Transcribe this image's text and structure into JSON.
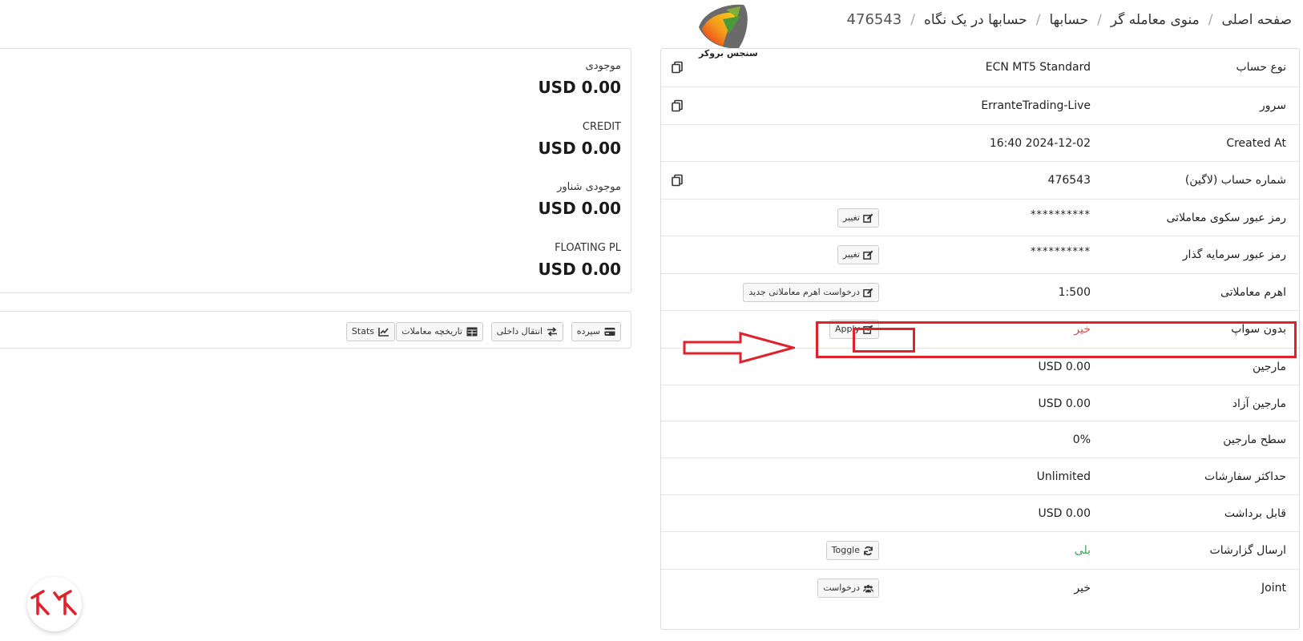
{
  "breadcrumb": {
    "home": "صفحه اصلی",
    "trader_menu": "منوی معامله گر",
    "accounts": "حسابها",
    "accounts_overview": "حسابها در یک نگاه",
    "account_id": "476543"
  },
  "logo": {
    "text": "سنجس بروکر"
  },
  "account": {
    "rows": [
      {
        "label": "نوع حساب",
        "value": "ECN MT5 Standard"
      },
      {
        "label": "سرور",
        "value": "ErranteTrading-Live"
      },
      {
        "label": "Created At",
        "value": "16:40 2024-12-02"
      },
      {
        "label": "شماره حساب (لاگین)",
        "value": "476543"
      },
      {
        "label": "رمز عبور سکوی معاملاتی",
        "value": "**********",
        "button": "تغییر"
      },
      {
        "label": "رمز عبور سرمایه گذار",
        "value": "**********",
        "button": "تغییر"
      },
      {
        "label": "اهرم معاملاتی",
        "value": "1:500",
        "button": "درخواست اهرم معاملاتی جدید"
      },
      {
        "label": "بدون سوآپ",
        "value": "خیر",
        "button": "Apply"
      },
      {
        "label": "مارجین",
        "value": "USD 0.00"
      },
      {
        "label": "مارجین آزاد",
        "value": "USD 0.00"
      },
      {
        "label": "سطح مارجین",
        "value": "0%"
      },
      {
        "label": "حداکثر سفارشات",
        "value": "Unlimited"
      },
      {
        "label": "قابل برداشت",
        "value": "USD 0.00"
      },
      {
        "label": "ارسال گزارشات",
        "value": "بلی",
        "button": "Toggle"
      },
      {
        "label": "Joint",
        "value": "خیر",
        "button": "درخواست"
      }
    ]
  },
  "balances": {
    "balance_label": "موجودی",
    "balance_value": "USD 0.00",
    "credit_label": "CREDIT",
    "credit_value": "USD 0.00",
    "equity_label": "موجودی شناور",
    "equity_value": "USD 0.00",
    "floating_label": "FLOATING PL",
    "floating_value": "USD 0.00"
  },
  "actions": {
    "deposit": "سپرده",
    "internal_transfer": "انتقال داخلی",
    "trade_history": "تاریخچه معاملات",
    "stats": "Stats"
  },
  "colors": {
    "highlight": "#e0222c",
    "no_value": "#d9534f",
    "yes_value": "#3aa657"
  },
  "icons": {
    "copy": "copy-icon",
    "edit": "edit-icon",
    "refresh": "refresh-icon",
    "users": "users-icon",
    "card": "credit-card-icon",
    "exchange": "exchange-icon",
    "table": "table-icon",
    "chart": "line-chart-icon"
  }
}
